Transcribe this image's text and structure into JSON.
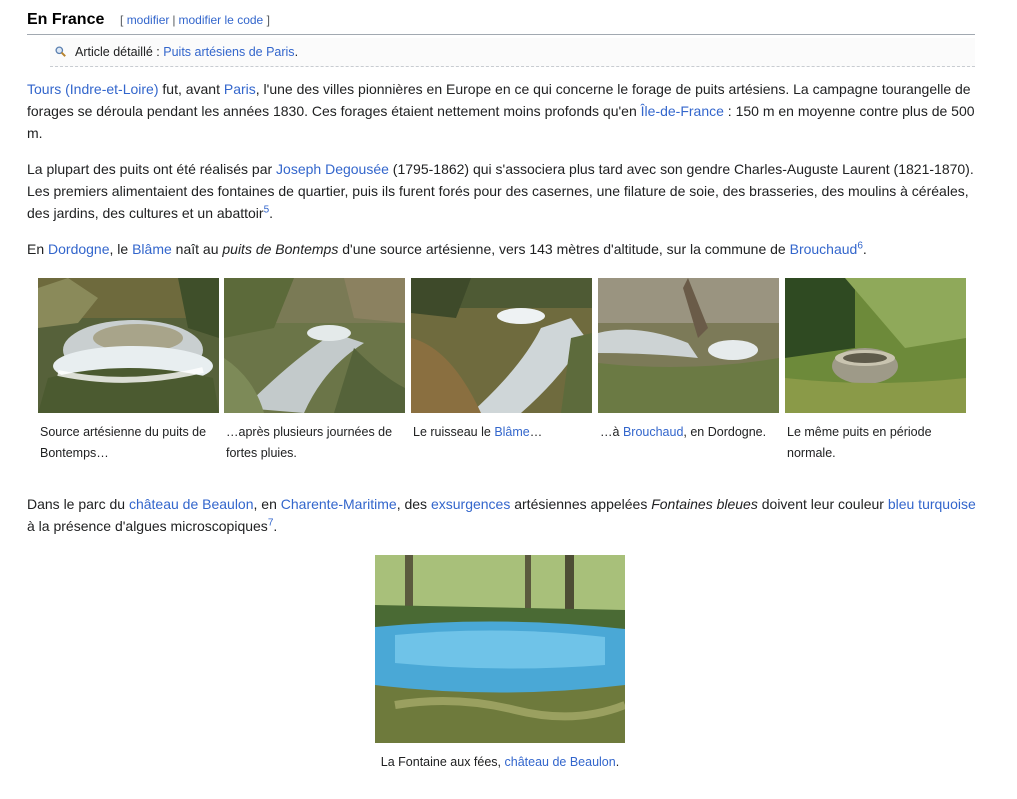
{
  "section": {
    "title": "En France",
    "edit_open": "[",
    "edit_modifier": "modifier",
    "edit_sep": "|",
    "edit_modifier_code": "modifier le code",
    "edit_close": "]"
  },
  "hatnote": {
    "prefix": "Article détaillé :",
    "link": "Puits artésiens de Paris",
    "suffix": "."
  },
  "p1": {
    "l_tours": "Tours (Indre-et-Loire)",
    "t1": " fut, avant ",
    "l_paris": "Paris",
    "t2": ", l'une des villes pionnières en Europe en ce qui concerne le forage de puits artésiens. La campagne tourangelle de forages se déroula pendant les années 1830. Ces forages étaient nettement moins profonds qu'en ",
    "l_idf": "Île-de-France",
    "t3": " : 150 m en moyenne contre plus de 500 m."
  },
  "p2": {
    "t1": "La plupart des puits ont été réalisés par ",
    "l_degousee": "Joseph Degousée",
    "t2": " (1795-1862) qui s'associera plus tard avec son gendre Charles-Auguste Laurent (1821-1870). Les premiers alimentaient des fontaines de quartier, puis ils furent forés pour des casernes, une filature de soie, des brasseries, des moulins à céréales, des jardins, des cultures et un abattoir",
    "ref": "5",
    "t3": "."
  },
  "p3": {
    "t1": "En ",
    "l_dordogne": "Dordogne",
    "t2": ", le ",
    "l_blame": "Blâme",
    "t3": " naît au ",
    "em": "puits de Bontemps",
    "t4": " d'une source artésienne, vers 143 mètres d'altitude, sur la commune de ",
    "l_brouchaud": "Brouchaud",
    "ref": "6",
    "t5": "."
  },
  "gallery": {
    "c1": "Source artésienne du puits de Bontemps…",
    "c2": "…après plusieurs journées de fortes pluies.",
    "c3_pre": "Le ruisseau le ",
    "c3_link": "Blâme",
    "c3_post": "…",
    "c4_pre": "…à ",
    "c4_link": "Brouchaud",
    "c4_post": ", en Dordogne.",
    "c5": "Le même puits en période normale."
  },
  "p4": {
    "t1": "Dans le parc du ",
    "l_chateau": "château de Beaulon",
    "t2": ", en ",
    "l_charente": "Charente-Maritime",
    "t3": ", des ",
    "l_exsurgences": "exsurgences",
    "t4": " artésiennes appelées ",
    "em": "Fontaines bleues",
    "t5": " doivent leur couleur ",
    "l_bleu": "bleu turquoise",
    "t6": " à la présence d'algues microscopiques",
    "ref": "7",
    "t7": "."
  },
  "figure": {
    "cap_pre": "La Fontaine aux fées, ",
    "cap_link": "château de Beaulon",
    "cap_post": "."
  },
  "colors": {
    "link": "#3366cc",
    "text": "#202122",
    "border": "#a2a9b1"
  }
}
